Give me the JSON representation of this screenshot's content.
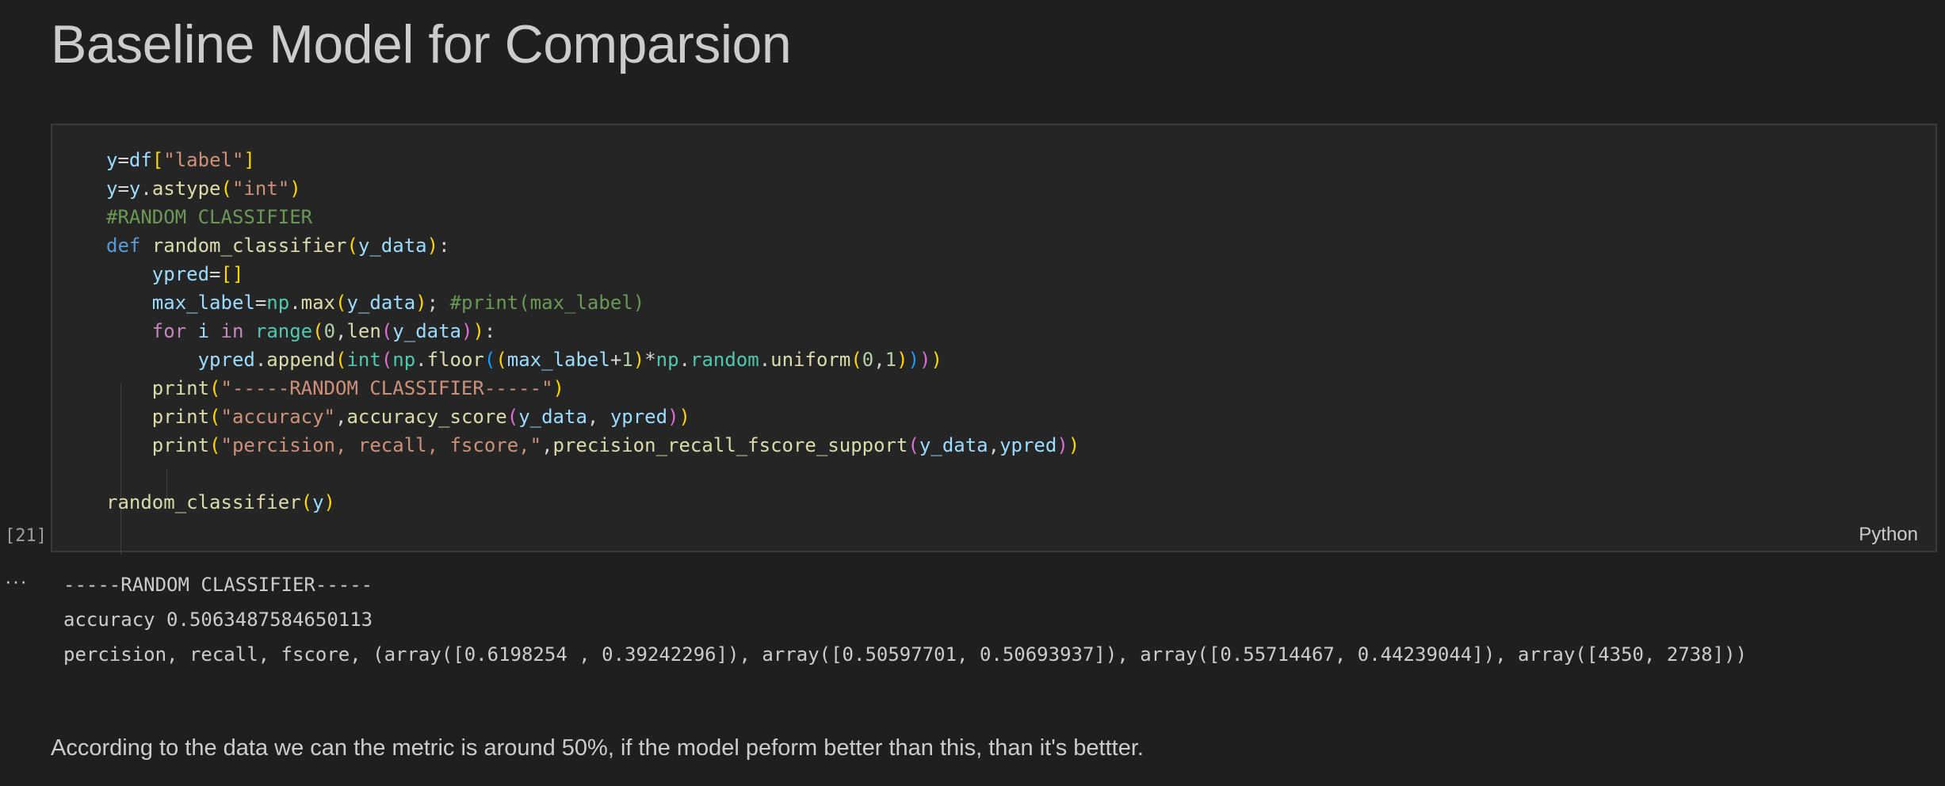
{
  "heading": "Baseline Model for Comparsion",
  "code_cell": {
    "execution_count": "[21]",
    "language": "Python",
    "lines": [
      "y=df[\"label\"]",
      "y=y.astype(\"int\")",
      "#RANDOM CLASSIFIER",
      "def random_classifier(y_data):",
      "    ypred=[]",
      "    max_label=np.max(y_data); #print(max_label)",
      "    for i in range(0,len(y_data)):",
      "        ypred.append(int(np.floor((max_label+1)*np.random.uniform(0,1))))",
      "    print(\"-----RANDOM CLASSIFIER-----\")",
      "    print(\"accuracy\",accuracy_score(y_data, ypred))",
      "    print(\"percision, recall, fscore,\",precision_recall_fscore_support(y_data,ypred))",
      "",
      "random_classifier(y)"
    ]
  },
  "output": {
    "menu_icon": "ellipsis-icon",
    "lines": [
      "-----RANDOM CLASSIFIER-----",
      "accuracy 0.5063487584650113",
      "percision, recall, fscore, (array([0.6198254 , 0.39242296]), array([0.50597701, 0.50693937]), array([0.55714467, 0.44239044]), array([4350, 2738]))"
    ]
  },
  "markdown": "According to the data we can the metric is around 50%, if the model peform better than this, than it's bettter."
}
